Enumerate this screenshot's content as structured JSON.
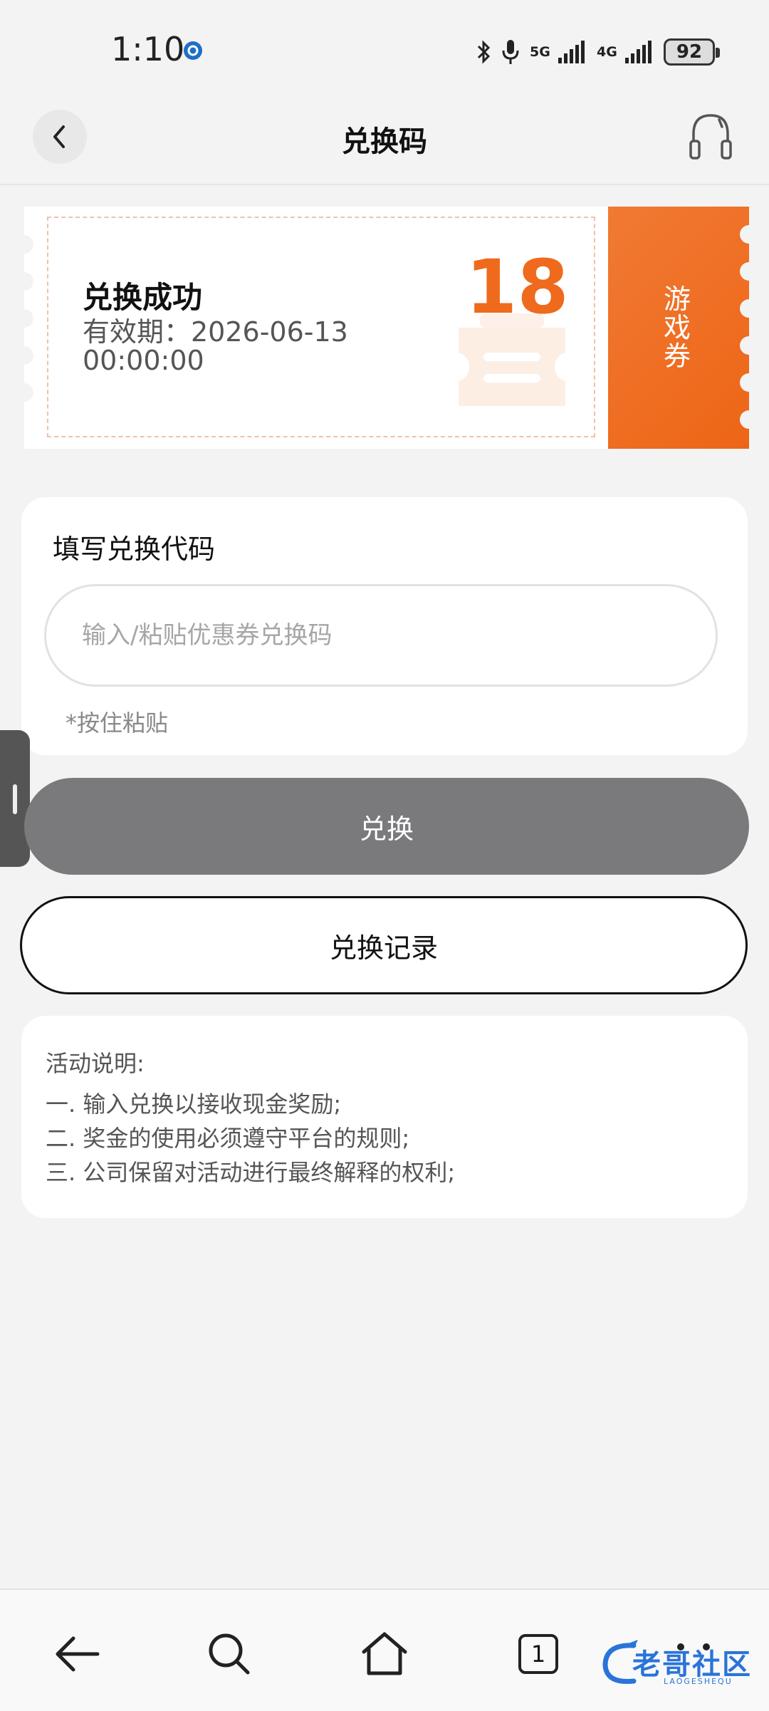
{
  "status_bar": {
    "time": "1:10",
    "network1": "5G",
    "network2": "4G",
    "battery": "92"
  },
  "header": {
    "title": "兑换码"
  },
  "coupon": {
    "title": "兑换成功",
    "validity": "有效期：2026-06-13 00:00:00",
    "amount": "18",
    "type": "游戏券",
    "accent_color": "#ef6a1c"
  },
  "code_form": {
    "label": "填写兑换代码",
    "input_value": "",
    "input_placeholder": "输入/粘贴优惠券兑换码",
    "paste_hint": "*按住粘贴"
  },
  "actions": {
    "redeem_label": "兑换",
    "history_label": "兑换记录"
  },
  "rules": {
    "title": "活动说明:",
    "items": [
      "一. 输入兑换以接收现金奖励;",
      "二. 奖金的使用必须遵守平台的规则;",
      "三. 公司保留对活动进行最终解释的权利;"
    ]
  },
  "nav": {
    "tab_count": "1",
    "icons": [
      "back-icon",
      "search-icon",
      "home-icon",
      "tabs-icon",
      "more-icon"
    ]
  },
  "watermark": {
    "text": "老哥社区",
    "sub": "LAOGESHEQU"
  }
}
